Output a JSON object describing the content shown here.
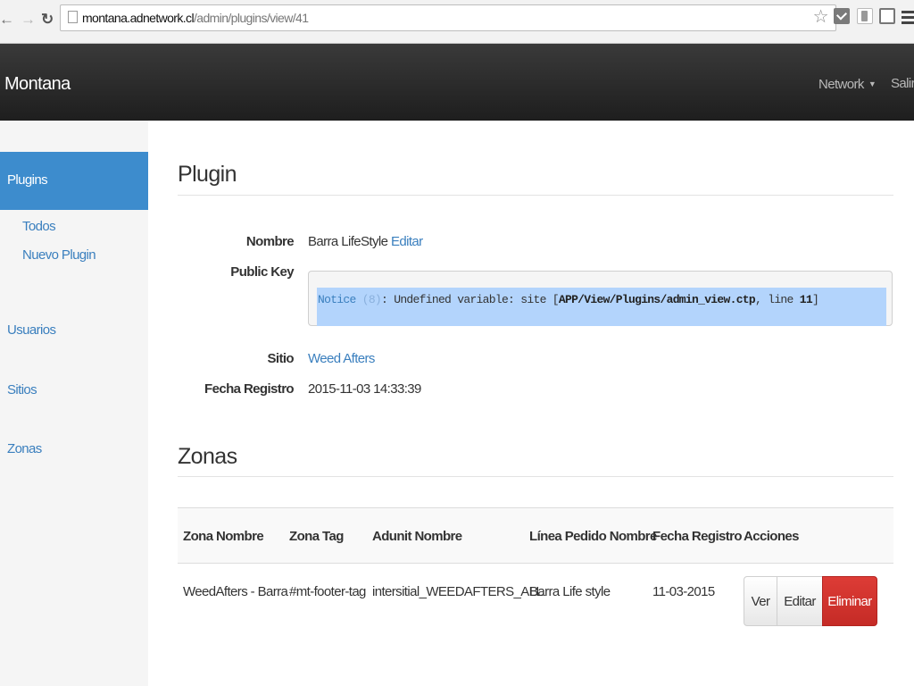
{
  "browser": {
    "url_host": "montana.adnetwork.cl",
    "url_path": "/admin/plugins/view/41"
  },
  "navbar": {
    "brand": "Montana",
    "network": "Network",
    "salir": "Salir"
  },
  "sidebar": {
    "plugins": "Plugins",
    "todos": "Todos",
    "nuevo_plugin": "Nuevo Plugin",
    "usuarios": "Usuarios",
    "sitios": "Sitios",
    "zonas": "Zonas"
  },
  "plugin": {
    "heading": "Plugin",
    "nombre_label": "Nombre",
    "nombre_value": "Barra LifeStyle",
    "editar_link": "Editar",
    "public_key_label": "Public Key",
    "notice_label": "Notice",
    "notice_code": "(8)",
    "notice_message": ": Undefined variable: site [",
    "notice_path": "APP/View/Plugins/admin_view.ctp",
    "notice_line_label": ", line ",
    "notice_line": "11",
    "notice_end": "]",
    "sitio_label": "Sitio",
    "sitio_value": "Weed Afters",
    "fecha_label": "Fecha Registro",
    "fecha_value": "2015-11-03 14:33:39"
  },
  "zonas": {
    "heading": "Zonas",
    "columns": [
      "Zona Nombre",
      "Zona Tag",
      "Adunit Nombre",
      "Línea Pedido Nombre",
      "Fecha Registro",
      "Acciones"
    ],
    "rows": [
      {
        "zona_nombre": "WeedAfters - Barra",
        "zona_tag": "#mt-footer-tag",
        "adunit_nombre": "intersitial_WEEDAFTERS_ALL",
        "linea_pedido": "Barra Life style",
        "fecha": "11-03-2015",
        "actions": {
          "ver": "Ver",
          "editar": "Editar",
          "eliminar": "Eliminar"
        }
      }
    ]
  }
}
